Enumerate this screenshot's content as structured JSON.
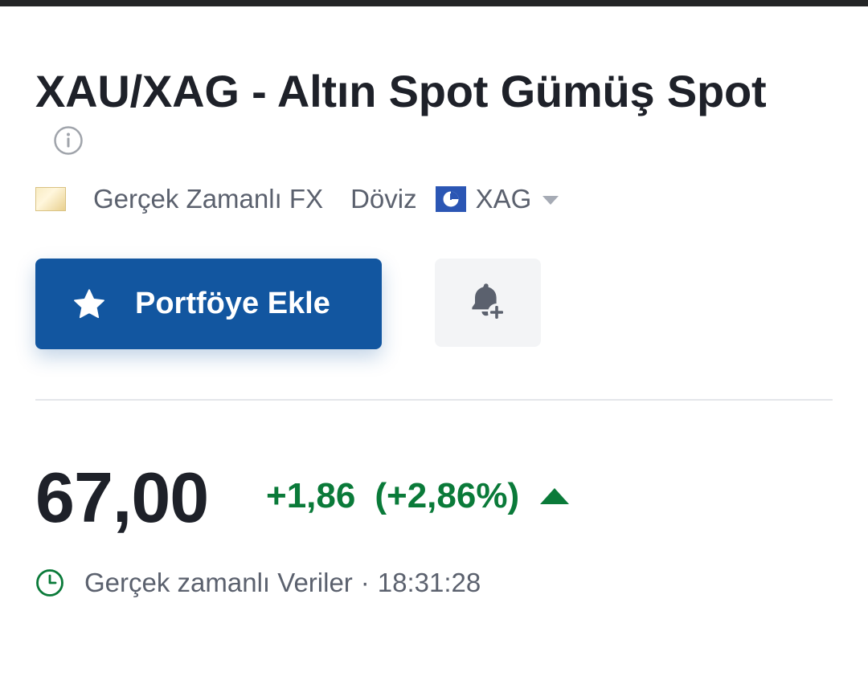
{
  "header": {
    "title": "XAU/XAG - Altın Spot Gümüş Spot"
  },
  "meta": {
    "exchange": "Gerçek Zamanlı FX",
    "category": "Döviz",
    "currency": "XAG"
  },
  "actions": {
    "portfolio_label": "Portföye Ekle"
  },
  "quote": {
    "price": "67,00",
    "change": "+1,86",
    "change_pct": "(+2,86%)",
    "direction": "up"
  },
  "status": {
    "label": "Gerçek zamanlı Veriler",
    "separator": "·",
    "time": "18:31:28"
  },
  "colors": {
    "accent": "#1256a0",
    "positive": "#0a7a39",
    "text": "#1e2129",
    "muted": "#5b616e"
  },
  "icons": {
    "info": "info-icon",
    "star": "star-icon",
    "alert": "bell-plus-icon",
    "clock": "clock-icon",
    "caret": "caret-down-icon",
    "trend": "arrow-up-icon"
  }
}
